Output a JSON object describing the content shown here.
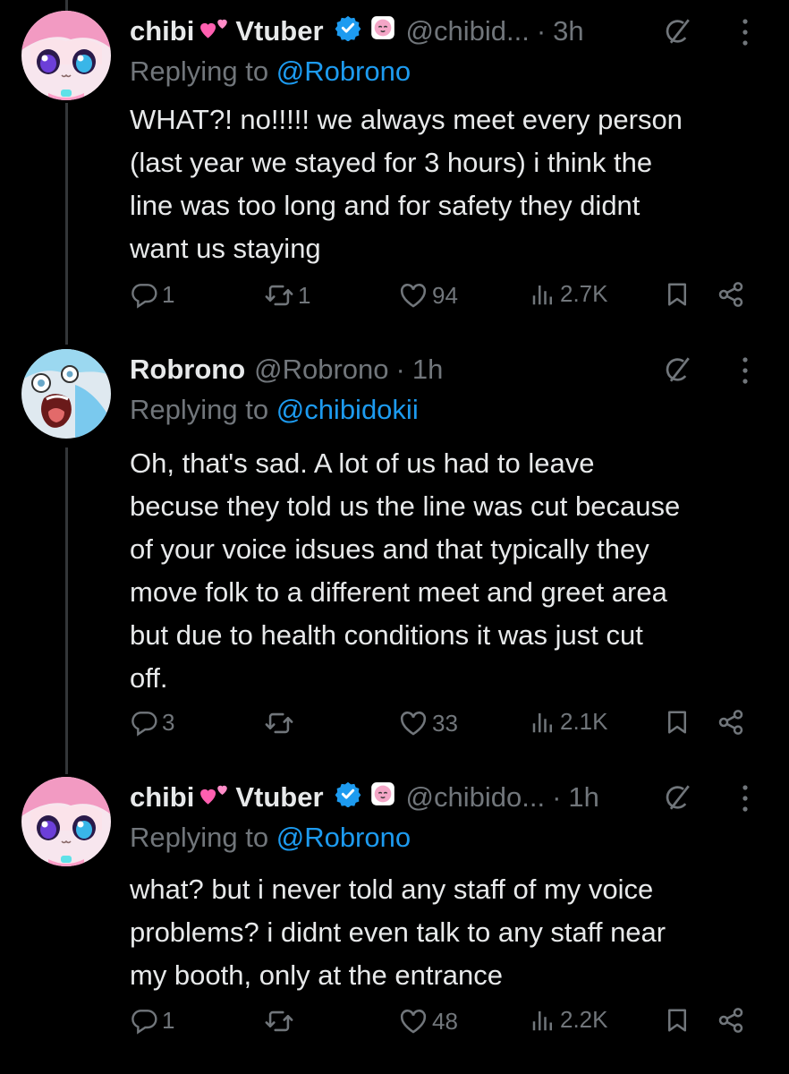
{
  "tweets": [
    {
      "display_name": "chibi",
      "name_suffix": "Vtuber",
      "handle": "@chibid...",
      "time": "3h",
      "replying_label": "Replying to",
      "replying_to": "@Robrono",
      "text": "WHAT?! no!!!!! we always meet every person\n(last year we stayed for 3 hours) i think the\nline was too long and for safety they didnt\nwant us staying",
      "replies": "1",
      "reposts": "1",
      "likes": "94",
      "views": "2.7K"
    },
    {
      "display_name": "Robrono",
      "name_suffix": "",
      "handle": "@Robrono",
      "time": "1h",
      "replying_label": "Replying to",
      "replying_to": "@chibidokii",
      "text": "Oh, that's sad. A lot of us had to leave\nbecuse they told us the line was cut because\nof your voice idsues and that typically they\nmove folk to a different meet and greet area\nbut due to health conditions it was just cut\noff.",
      "replies": "3",
      "reposts": "",
      "likes": "33",
      "views": "2.1K"
    },
    {
      "display_name": "chibi",
      "name_suffix": "Vtuber",
      "handle": "@chibido...",
      "time": "1h",
      "replying_label": "Replying to",
      "replying_to": "@Robrono",
      "text": "what? but i never told any staff of my voice\nproblems? i didnt even talk to any staff near\nmy booth, only at the entrance",
      "replies": "1",
      "reposts": "",
      "likes": "48",
      "views": "2.2K"
    }
  ],
  "colors": {
    "background": "#000000",
    "text": "#e7e9ea",
    "secondary": "#71767b",
    "link": "#1d9bf0",
    "heart_emoji": "#ff5fb0"
  },
  "icons": [
    "avatar-chibi",
    "avatar-robrono",
    "pink-heart-emoji",
    "verified-icon",
    "affiliate-badge-icon",
    "grok-icon",
    "more-icon",
    "reply-icon",
    "repost-icon",
    "like-icon",
    "views-icon",
    "bookmark-icon",
    "share-icon"
  ]
}
